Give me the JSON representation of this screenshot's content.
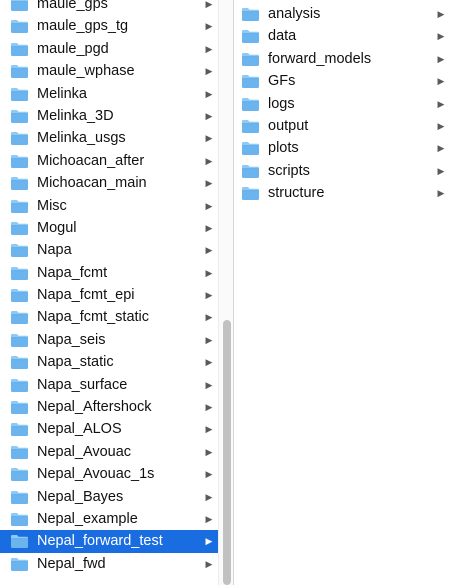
{
  "colors": {
    "folder_fill": "#6cb4ee",
    "folder_tab": "#8ccaf7",
    "selection": "#1a6de0"
  },
  "icons": {
    "folder": "folder-icon",
    "disclosure": "chevron-right-icon"
  },
  "column_left": {
    "chevron_glyph": "▶",
    "items": [
      {
        "label": "maule_gps"
      },
      {
        "label": "maule_gps_tg"
      },
      {
        "label": "maule_pgd"
      },
      {
        "label": "maule_wphase"
      },
      {
        "label": "Melinka"
      },
      {
        "label": "Melinka_3D"
      },
      {
        "label": "Melinka_usgs"
      },
      {
        "label": "Michoacan_after"
      },
      {
        "label": "Michoacan_main"
      },
      {
        "label": "Misc"
      },
      {
        "label": "Mogul"
      },
      {
        "label": "Napa"
      },
      {
        "label": "Napa_fcmt"
      },
      {
        "label": "Napa_fcmt_epi"
      },
      {
        "label": "Napa_fcmt_static"
      },
      {
        "label": "Napa_seis"
      },
      {
        "label": "Napa_static"
      },
      {
        "label": "Napa_surface"
      },
      {
        "label": "Nepal_Aftershock"
      },
      {
        "label": "Nepal_ALOS"
      },
      {
        "label": "Nepal_Avouac"
      },
      {
        "label": "Nepal_Avouac_1s"
      },
      {
        "label": "Nepal_Bayes"
      },
      {
        "label": "Nepal_example"
      },
      {
        "label": "Nepal_forward_test",
        "selected": true
      },
      {
        "label": "Nepal_fwd"
      }
    ]
  },
  "column_right": {
    "chevron_glyph": "▶",
    "items": [
      {
        "label": "analysis"
      },
      {
        "label": "data"
      },
      {
        "label": "forward_models"
      },
      {
        "label": "GFs"
      },
      {
        "label": "logs"
      },
      {
        "label": "output"
      },
      {
        "label": "plots"
      },
      {
        "label": "scripts"
      },
      {
        "label": "structure"
      }
    ]
  }
}
